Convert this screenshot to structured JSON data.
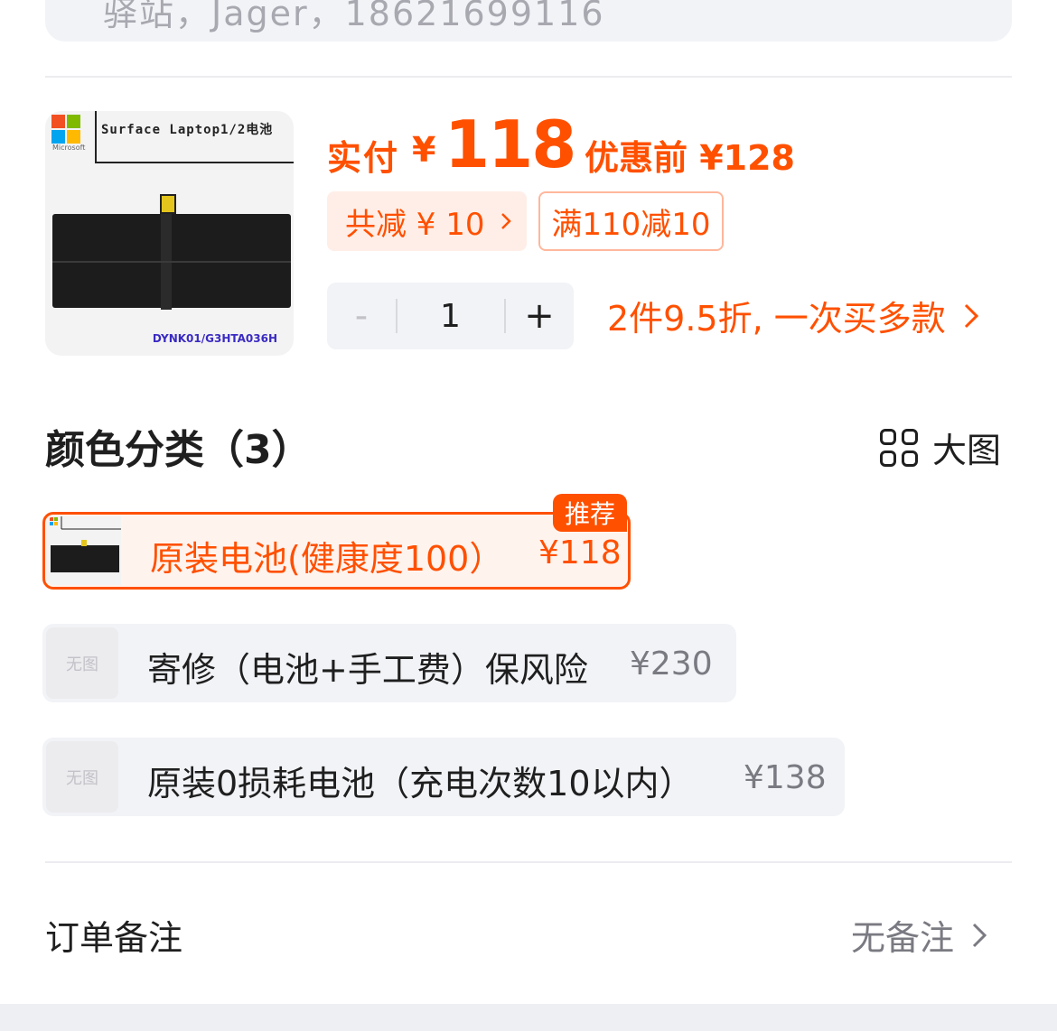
{
  "address": {
    "partial_text": "驿站，Jager，18621699116"
  },
  "product": {
    "image": {
      "brand_text": "Microsoft",
      "title_text": "Surface Laptop1/2电池",
      "code_text": "DYNK01/G3HTA036H",
      "logo_colors": [
        "#f25022",
        "#7fba00",
        "#00a4ef",
        "#ffb900"
      ]
    },
    "price": {
      "label": "实付",
      "currency": "¥",
      "amount": "118",
      "original_label": "优惠前 ¥128"
    },
    "discount_chip": {
      "text": "共减 ¥ 10",
      "chevron": "chevron-right-icon"
    },
    "coupon_chip": {
      "text": "满110减10"
    },
    "quantity": {
      "minus": "-",
      "value": "1",
      "plus": "+"
    },
    "promo": {
      "text": "2件9.5折, 一次买多款",
      "chevron": "chevron-right-icon"
    }
  },
  "variants": {
    "title": "颜色分类（3）",
    "big_image_label": "大图",
    "recommend_badge": "推荐",
    "options": [
      {
        "name": "原装电池(健康度100）",
        "price": "¥118",
        "thumb": "",
        "selected": true
      },
      {
        "name": "寄修（电池+手工费）保风险",
        "price": "¥230",
        "thumb": "无图",
        "selected": false
      },
      {
        "name": "原装0损耗电池（充电次数10以内）",
        "price": "¥138",
        "thumb": "无图",
        "selected": false
      }
    ]
  },
  "remark": {
    "label": "订单备注",
    "value": "无备注"
  },
  "colors": {
    "accent": "#ff5000",
    "panel": "#f2f3f7",
    "muted": "#7a7a82"
  }
}
